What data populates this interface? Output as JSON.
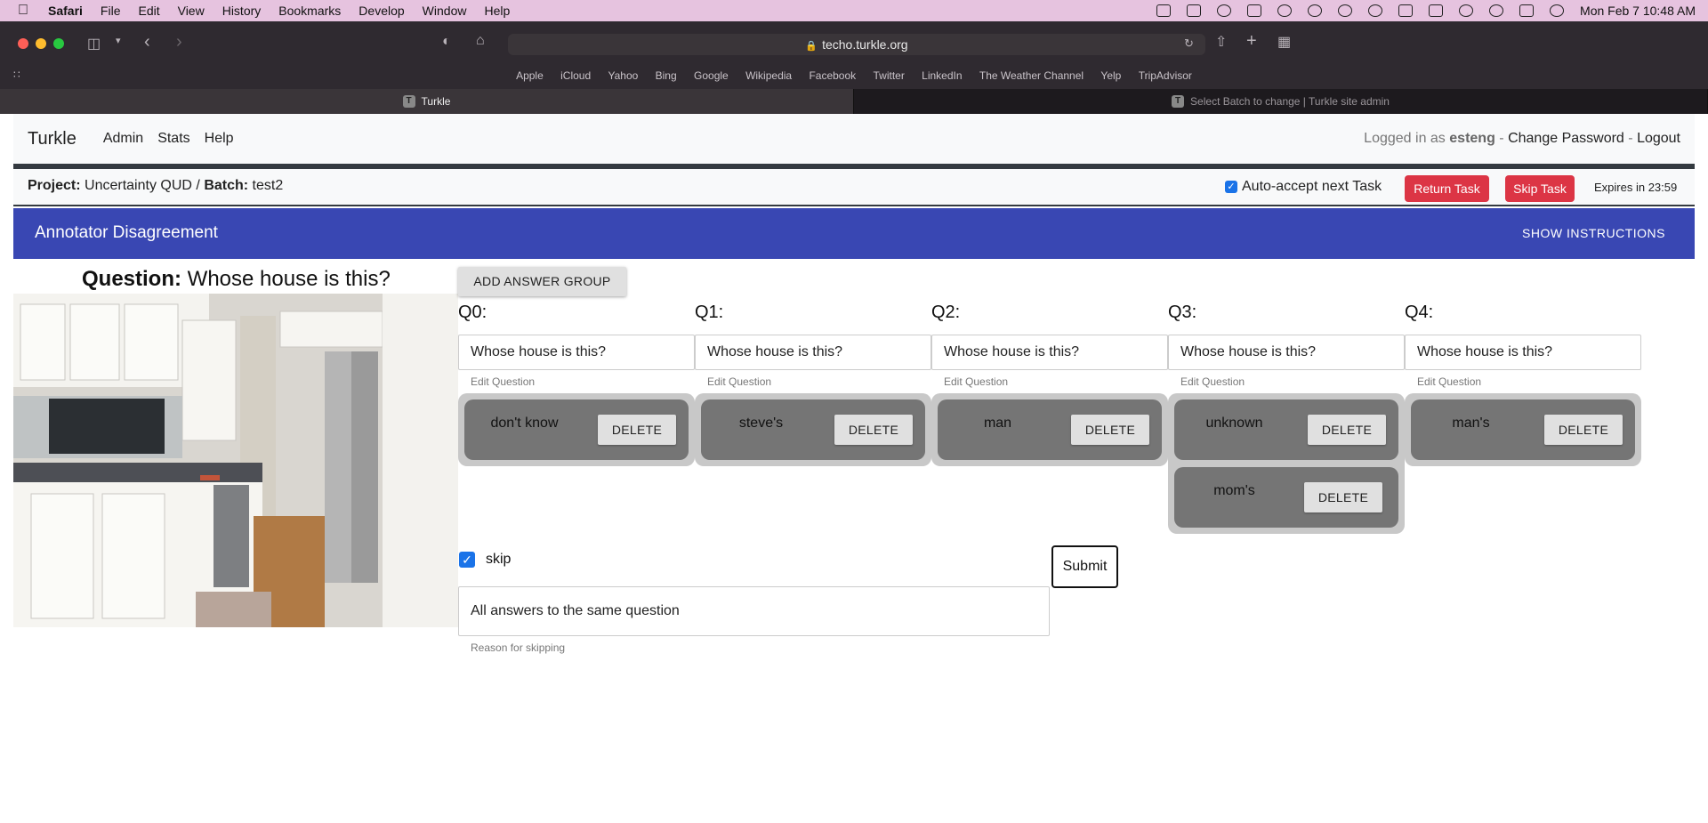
{
  "menubar": {
    "app": "Safari",
    "items": [
      "File",
      "Edit",
      "View",
      "History",
      "Bookmarks",
      "Develop",
      "Window",
      "Help"
    ],
    "clock": "Mon Feb 7  10:48 AM"
  },
  "browser": {
    "url": "techo.turkle.org",
    "favorites": [
      "Apple",
      "iCloud",
      "Yahoo",
      "Bing",
      "Google",
      "Wikipedia",
      "Facebook",
      "Twitter",
      "LinkedIn",
      "The Weather Channel",
      "Yelp",
      "TripAdvisor"
    ],
    "tabs": [
      {
        "favicon": "T",
        "label": "Turkle"
      },
      {
        "favicon": "T",
        "label": "Select Batch to change | Turkle site admin"
      }
    ]
  },
  "navbar": {
    "brand": "Turkle",
    "links": [
      "Admin",
      "Stats",
      "Help"
    ],
    "logged_prefix": "Logged in as",
    "user": "esteng",
    "sep": "-",
    "change_password": "Change Password",
    "logout": "Logout"
  },
  "project": {
    "project_label": "Project:",
    "project_name": "Uncertainty QUD",
    "slash": "/",
    "batch_label": "Batch:",
    "batch_name": "test2",
    "auto_accept": "Auto-accept next Task",
    "return_task": "Return Task",
    "skip_task": "Skip Task",
    "expires": "Expires in 23:59"
  },
  "banner": {
    "title": "Annotator Disagreement",
    "show_instructions": "SHOW INSTRUCTIONS"
  },
  "question": {
    "label": "Question:",
    "text": "Whose house is this?"
  },
  "add_answer_group": "ADD ANSWER GROUP",
  "columns": [
    {
      "label": "Q0:",
      "value": "Whose house is this?",
      "help": "Edit Question",
      "answers": [
        "don't know"
      ]
    },
    {
      "label": "Q1:",
      "value": "Whose house is this?",
      "help": "Edit Question",
      "answers": [
        "steve's"
      ]
    },
    {
      "label": "Q2:",
      "value": "Whose house is this?",
      "help": "Edit Question",
      "answers": [
        "man"
      ]
    },
    {
      "label": "Q3:",
      "value": "Whose house is this?",
      "help": "Edit Question",
      "answers": [
        "unknown",
        "mom's"
      ]
    },
    {
      "label": "Q4:",
      "value": "Whose house is this?",
      "help": "Edit Question",
      "answers": [
        "man's"
      ]
    }
  ],
  "delete_label": "DELETE",
  "skip": {
    "label": "skip",
    "reason": "All answers to the same question",
    "reason_help": "Reason for skipping"
  },
  "submit": "Submit",
  "colors": {
    "banner": "#3947b3",
    "danger": "#dc3545",
    "checkbox": "#1a73e8",
    "group_outer": "#c8c8c8",
    "group_inner": "#757575"
  }
}
